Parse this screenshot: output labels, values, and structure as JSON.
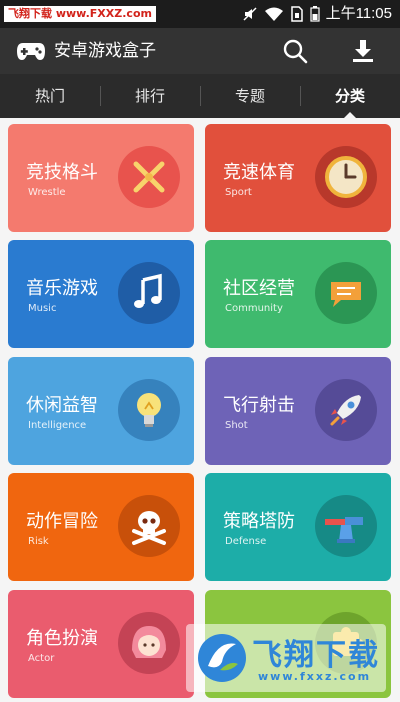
{
  "status_bar": {
    "watermark_text": "飞翔下载 www.FXXZ.com",
    "time": "上午11:05",
    "icons": [
      "mute-icon",
      "wifi-icon",
      "sim-icon",
      "battery-icon"
    ]
  },
  "app_bar": {
    "title": "安卓游戏盒子",
    "logo_icon": "gamepad-icon",
    "actions": [
      "search-icon",
      "download-icon"
    ]
  },
  "tabs": [
    {
      "label": "热门",
      "active": false
    },
    {
      "label": "排行",
      "active": false
    },
    {
      "label": "专题",
      "active": false
    },
    {
      "label": "分类",
      "active": true
    }
  ],
  "categories": [
    {
      "name": "竞技格斗",
      "sub": "Wrestle",
      "color": "#f47a6e",
      "badge_color": "#e8534d",
      "icon": "crossed-swords-icon"
    },
    {
      "name": "竞速体育",
      "sub": "Sport",
      "color": "#e1503c",
      "badge_color": "#b8382b",
      "icon": "clock-icon"
    },
    {
      "name": "音乐游戏",
      "sub": "Music",
      "color": "#2a7bd0",
      "badge_color": "#1f5da6",
      "icon": "music-note-icon"
    },
    {
      "name": "社区经营",
      "sub": "Community",
      "color": "#3fba6e",
      "badge_color": "#2b9654",
      "icon": "chat-bubble-icon"
    },
    {
      "name": "休闲益智",
      "sub": "Intelligence",
      "color": "#4ea4df",
      "badge_color": "#3682bd",
      "icon": "lightbulb-icon"
    },
    {
      "name": "飞行射击",
      "sub": "Shot",
      "color": "#6e63b7",
      "badge_color": "#554b97",
      "icon": "rocket-icon"
    },
    {
      "name": "动作冒险",
      "sub": "Risk",
      "color": "#f0660f",
      "badge_color": "#c8500a",
      "icon": "skull-icon"
    },
    {
      "name": "策略塔防",
      "sub": "Defense",
      "color": "#1dada8",
      "badge_color": "#168a86",
      "icon": "tower-defense-icon"
    },
    {
      "name": "角色扮演",
      "sub": "Actor",
      "color": "#ea5c6e",
      "badge_color": "#c44355",
      "icon": "girl-face-icon"
    },
    {
      "name": "",
      "sub": "",
      "color": "#8bc53f",
      "badge_color": "#6ea42c",
      "icon": "puzzle-icon"
    }
  ],
  "watermark_logo": {
    "main": "飞翔下载",
    "url": "www.fxxz.com"
  }
}
